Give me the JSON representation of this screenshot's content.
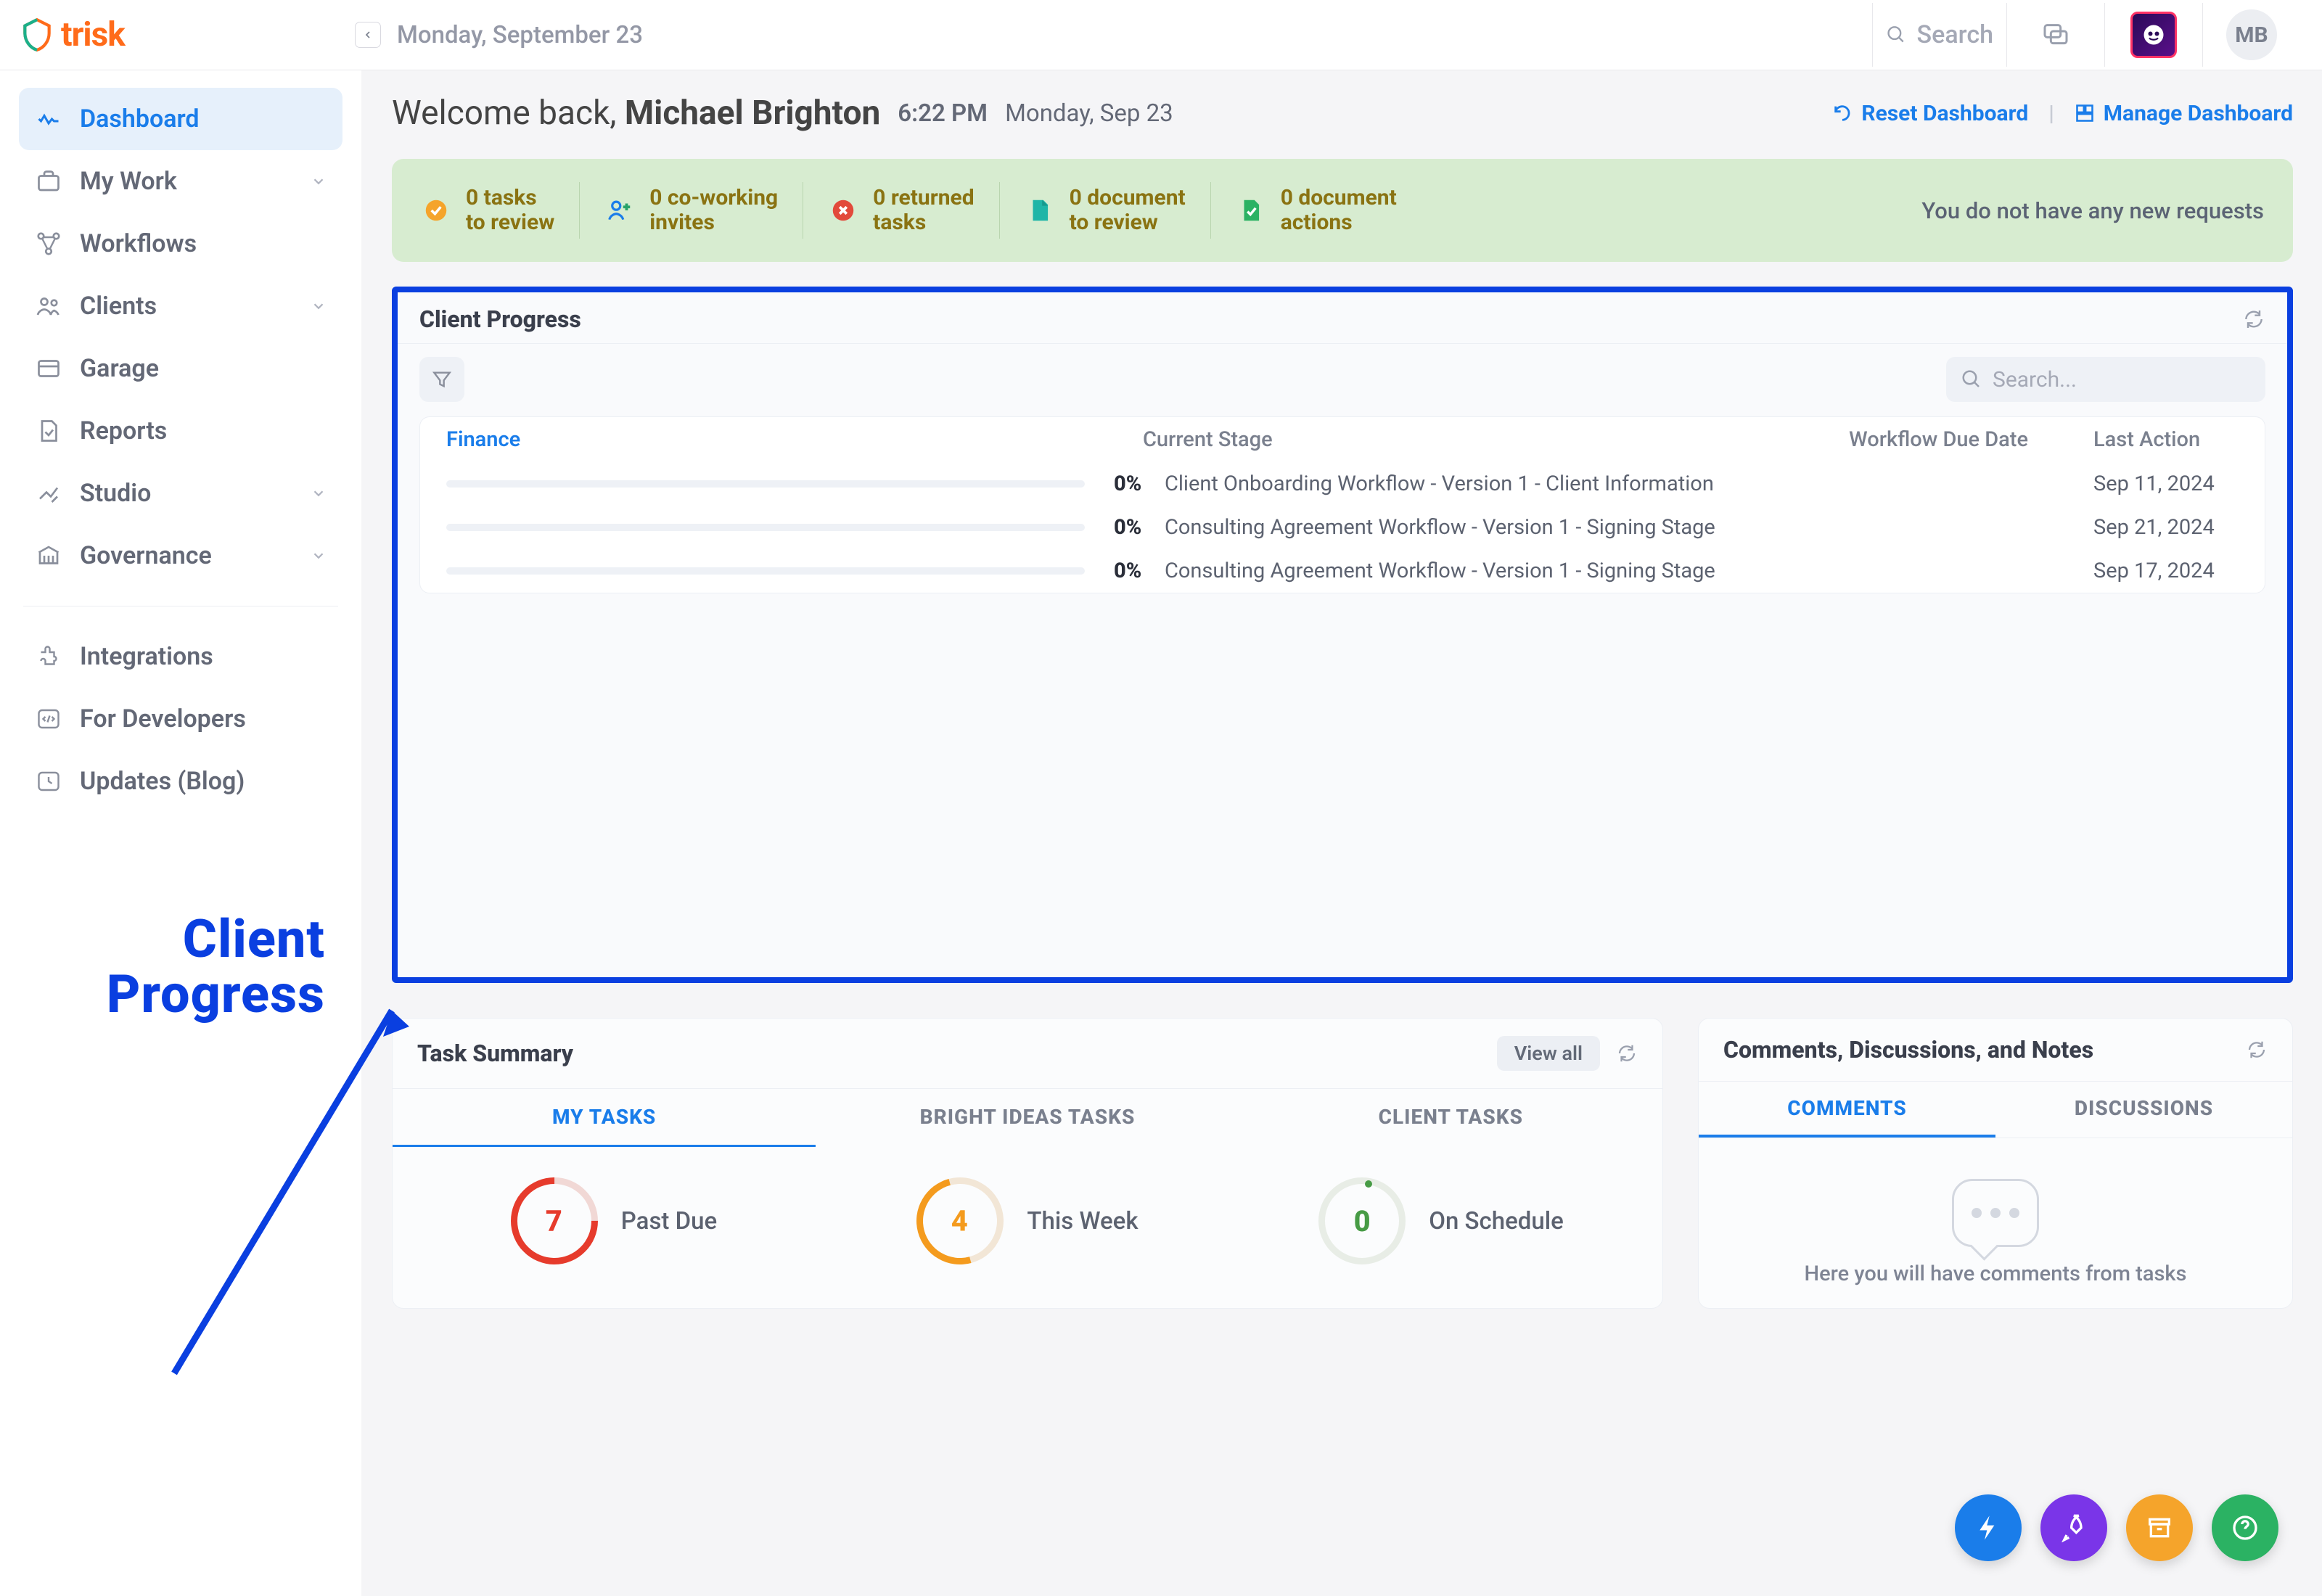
{
  "brand": "trisk",
  "topbar": {
    "date": "Monday, September 23",
    "search_placeholder": "Search",
    "user_initials": "MB"
  },
  "sidebar": {
    "items": [
      {
        "label": "Dashboard"
      },
      {
        "label": "My Work"
      },
      {
        "label": "Workflows"
      },
      {
        "label": "Clients"
      },
      {
        "label": "Garage"
      },
      {
        "label": "Reports"
      },
      {
        "label": "Studio"
      },
      {
        "label": "Governance"
      }
    ],
    "extras": [
      {
        "label": "Integrations"
      },
      {
        "label": "For Developers"
      },
      {
        "label": "Updates (Blog)"
      }
    ]
  },
  "welcome": {
    "prefix": "Welcome back,",
    "name": "Michael Brighton",
    "time": "6:22 PM",
    "date": "Monday, Sep 23"
  },
  "dash_actions": {
    "reset": "Reset Dashboard",
    "manage": "Manage Dashboard"
  },
  "requests": {
    "items": [
      {
        "l1": "0 tasks",
        "l2": "to review"
      },
      {
        "l1": "0 co-working",
        "l2": "invites"
      },
      {
        "l1": "0 returned",
        "l2": "tasks"
      },
      {
        "l1": "0 document",
        "l2": "to review"
      },
      {
        "l1": "0 document",
        "l2": "actions"
      }
    ],
    "msg": "You do not have any new requests"
  },
  "client_progress": {
    "title": "Client Progress",
    "search_placeholder": "Search...",
    "group": "Finance",
    "cols": {
      "stage": "Current Stage",
      "due": "Workflow Due Date",
      "last": "Last Action"
    },
    "rows": [
      {
        "pct": "0%",
        "stage": "Client Onboarding Workflow - Version 1 - Client Information",
        "last": "Sep 11, 2024"
      },
      {
        "pct": "0%",
        "stage": "Consulting Agreement Workflow - Version 1 - Signing Stage",
        "last": "Sep 21, 2024"
      },
      {
        "pct": "0%",
        "stage": "Consulting Agreement Workflow - Version 1 - Signing Stage",
        "last": "Sep 17, 2024"
      }
    ]
  },
  "callout": {
    "l1": "Client",
    "l2": "Progress"
  },
  "task_summary": {
    "title": "Task Summary",
    "view_all": "View all",
    "tabs": [
      "MY TASKS",
      "BRIGHT IDEAS TASKS",
      "CLIENT TASKS"
    ],
    "metrics": [
      {
        "value": "7",
        "label": "Past Due"
      },
      {
        "value": "4",
        "label": "This Week"
      },
      {
        "value": "0",
        "label": "On Schedule"
      }
    ]
  },
  "comments": {
    "title": "Comments, Discussions, and Notes",
    "tabs": [
      "COMMENTS",
      "DISCUSSIONS"
    ],
    "hint": "Here you will have comments from tasks"
  }
}
